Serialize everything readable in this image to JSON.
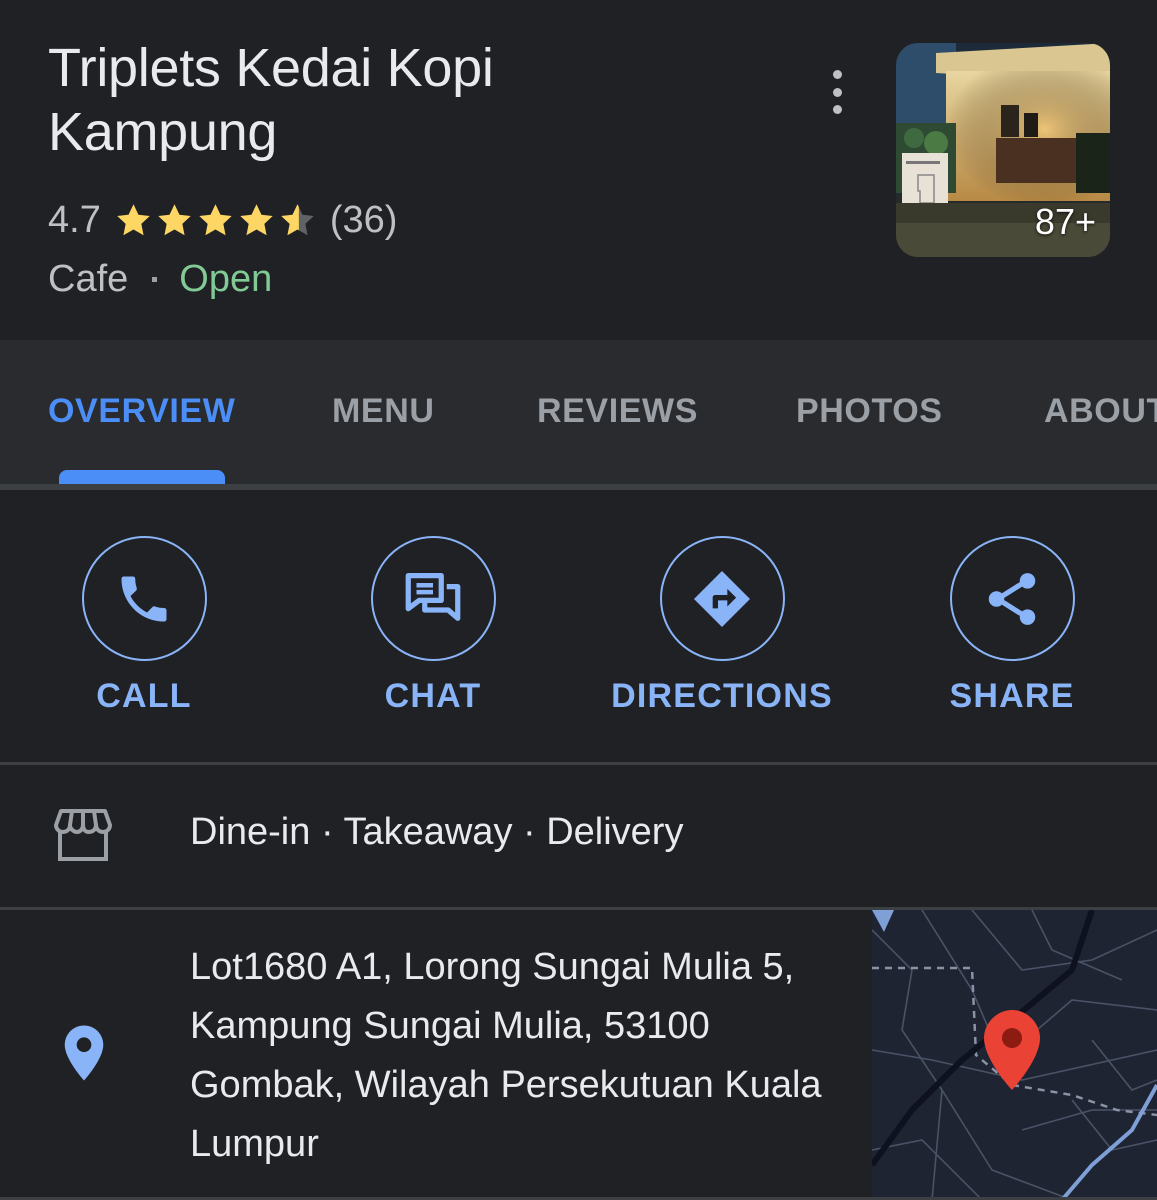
{
  "place": {
    "name": "Triplets Kedai Kopi Kampung",
    "rating": "4.7",
    "rating_value": 4.7,
    "reviews_count": "(36)",
    "category": "Cafe",
    "status": "Open",
    "photo_count": "87+"
  },
  "tabs": [
    {
      "label": "OVERVIEW",
      "active": true
    },
    {
      "label": "MENU",
      "active": false
    },
    {
      "label": "REVIEWS",
      "active": false
    },
    {
      "label": "PHOTOS",
      "active": false
    },
    {
      "label": "ABOUT",
      "active": false
    }
  ],
  "actions": [
    {
      "label": "CALL",
      "icon": "phone-icon"
    },
    {
      "label": "CHAT",
      "icon": "chat-icon"
    },
    {
      "label": "DIRECTIONS",
      "icon": "directions-icon"
    },
    {
      "label": "SHARE",
      "icon": "share-icon"
    }
  ],
  "service_options": {
    "icon": "storefront-icon",
    "text": "Dine-in · Takeaway · Delivery"
  },
  "address": {
    "icon": "location-pin-icon",
    "text": "Lot1680 A1, Lorong Sungai Mulia 5, Kampung Sungai Mulia, 53100 Gombak, Wilayah Persekutuan Kuala Lumpur"
  },
  "colors": {
    "background": "#202124",
    "accent_blue": "#8ab4f8",
    "active_tab_blue": "#4c8ef7",
    "open_green": "#81c995",
    "star_yellow": "#fdd663",
    "map_pin_red": "#ea4335"
  }
}
